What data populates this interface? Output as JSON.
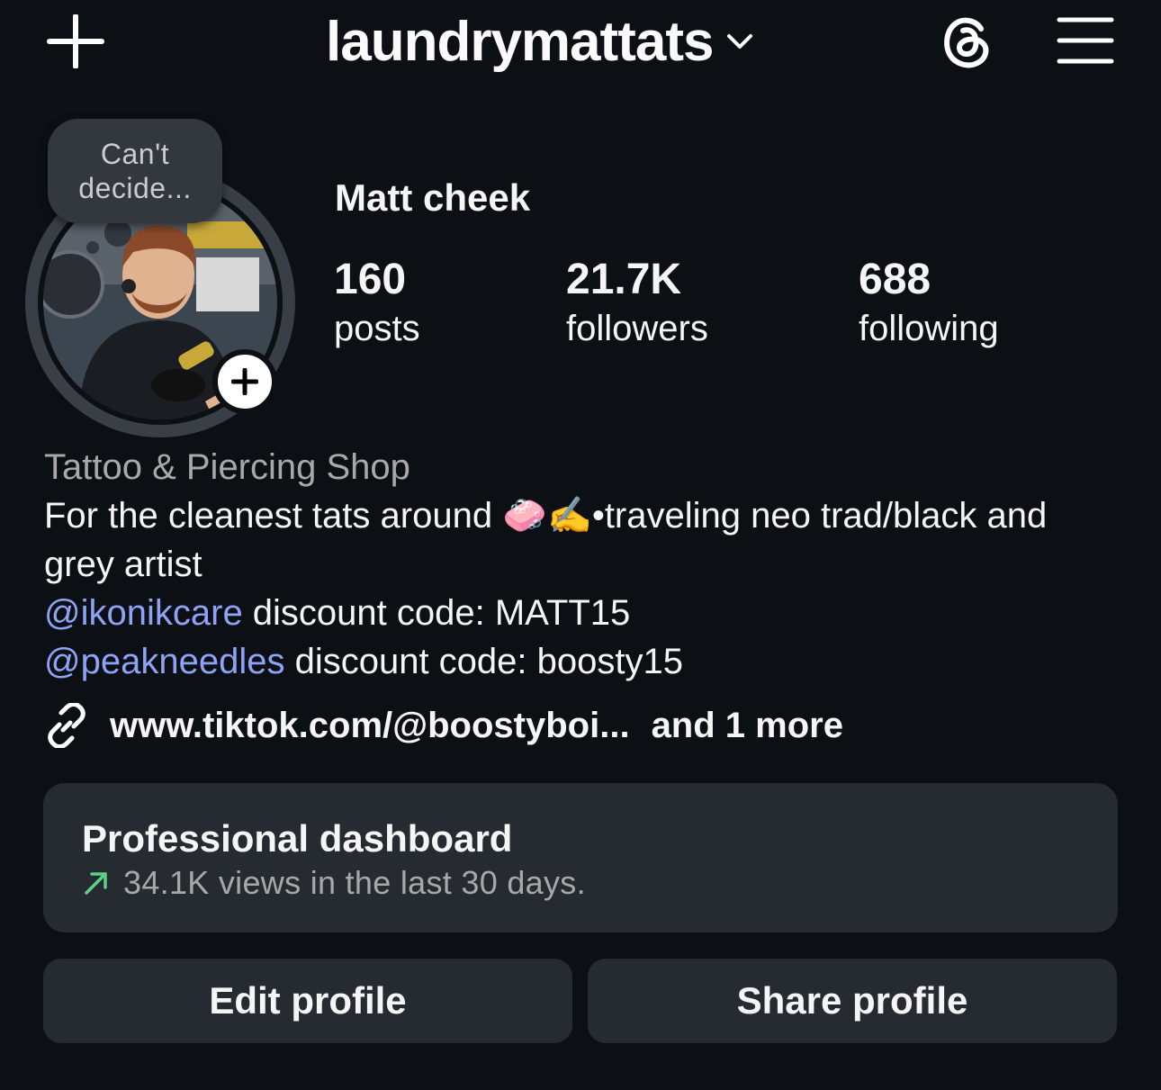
{
  "header": {
    "username": "laundrymattats",
    "create_icon": "plus-icon",
    "dropdown_icon": "chevron-down-icon",
    "threads_icon": "threads-icon",
    "menu_icon": "hamburger-menu-icon"
  },
  "note": {
    "text": "Can't decide..."
  },
  "profile": {
    "display_name": "Matt cheek",
    "stats": [
      {
        "value": "160",
        "label": "posts"
      },
      {
        "value": "21.7K",
        "label": "followers"
      },
      {
        "value": "688",
        "label": "following"
      }
    ]
  },
  "bio": {
    "category": "Tattoo & Piercing Shop",
    "line1_pre": "For the cleanest tats around ",
    "emoji1": "🧼",
    "emoji2": "✍️",
    "line1_post": "•traveling neo trad/black and grey artist",
    "mention1": "@ikonikcare",
    "mention1_text": " discount code: MATT15",
    "mention2": "@peakneedles",
    "mention2_text": " discount code: boosty15",
    "link": "www.tiktok.com/@boostyboi...",
    "link_more": "and 1 more"
  },
  "dashboard": {
    "title": "Professional dashboard",
    "subtitle": "34.1K views in the last 30 days.",
    "trend_color": "#5fd08a"
  },
  "buttons": {
    "edit": "Edit profile",
    "share": "Share profile"
  },
  "colors": {
    "background": "#0c1014",
    "card": "#262a31",
    "mention": "#8ea3f5",
    "secondary_text": "#a8a8a8"
  }
}
